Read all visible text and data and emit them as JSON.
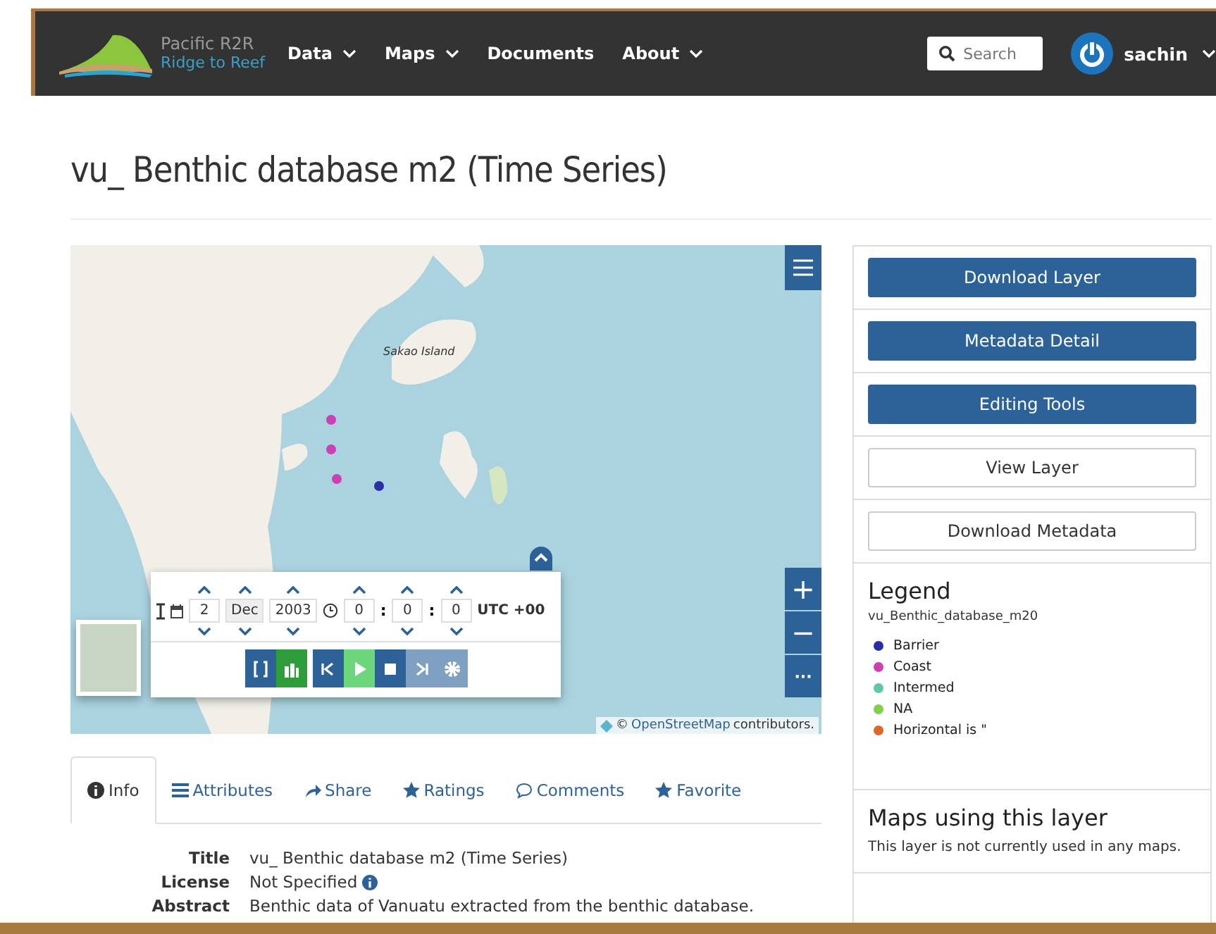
{
  "navbar": {
    "logo_line1": "Pacific R2R",
    "logo_line2": "Ridge to Reef",
    "menu": [
      {
        "label": "Data",
        "dropdown": true
      },
      {
        "label": "Maps",
        "dropdown": true
      },
      {
        "label": "Documents",
        "dropdown": false
      },
      {
        "label": "About",
        "dropdown": true
      }
    ],
    "search": {
      "placeholder": "Search"
    },
    "user": "sachin"
  },
  "page_title": "vu_ Benthic database m2 (Time Series)",
  "map": {
    "place_label": "Sakao Island",
    "attribution_link": "OpenStreetMap",
    "attribution_text": "contributors.",
    "copyright": "©",
    "time": {
      "fields": [
        {
          "kind": "day",
          "value": "2"
        },
        {
          "kind": "month",
          "value": "Dec"
        },
        {
          "kind": "year",
          "value": "2003"
        },
        {
          "kind": "hour",
          "value": "0"
        },
        {
          "kind": "minute",
          "value": "0",
          "separator": ":"
        },
        {
          "kind": "second",
          "value": "0",
          "separator": ":"
        }
      ],
      "zone": "UTC +00"
    },
    "player": [
      {
        "kind": "range",
        "disabled": false
      },
      {
        "kind": "layers",
        "disabled": false
      },
      {
        "kind": "first",
        "disabled": false
      },
      {
        "kind": "play",
        "disabled": false
      },
      {
        "kind": "stop",
        "disabled": false
      },
      {
        "kind": "last",
        "disabled": true
      },
      {
        "kind": "settings",
        "disabled": true
      }
    ],
    "zoom_in": "+",
    "zoom_out": "−",
    "more": "···"
  },
  "actions": [
    {
      "label": "Download Layer",
      "primary": true
    },
    {
      "label": "Metadata Detail",
      "primary": true
    },
    {
      "label": "Editing Tools",
      "primary": true
    },
    {
      "label": "View Layer",
      "primary": false
    },
    {
      "label": "Download Metadata",
      "primary": false
    }
  ],
  "legend": {
    "title": "Legend",
    "layer": "vu_Benthic_database_m20",
    "items": [
      {
        "label": "Barrier",
        "color": "#2a2fa8"
      },
      {
        "label": "Coast",
        "color": "#cc3fb5"
      },
      {
        "label": "Intermed",
        "color": "#5cc8a8"
      },
      {
        "label": "NA",
        "color": "#7fd04a"
      },
      {
        "label": "Horizontal is \"",
        "color": "#e0662a"
      }
    ]
  },
  "maps_using": {
    "title": "Maps using this layer",
    "text": "This layer is not currently used in any maps."
  },
  "tabs": [
    {
      "label": "Info",
      "kind": "info",
      "selected": true
    },
    {
      "label": "Attributes",
      "kind": "list",
      "selected": false
    },
    {
      "label": "Share",
      "kind": "share",
      "selected": false
    },
    {
      "label": "Ratings",
      "kind": "star",
      "selected": false
    },
    {
      "label": "Comments",
      "kind": "comment",
      "selected": false
    },
    {
      "label": "Favorite",
      "kind": "star",
      "selected": false
    }
  ],
  "info": [
    {
      "key": "Title",
      "value": "vu_ Benthic database m2 (Time Series)",
      "info_icon": false
    },
    {
      "key": "License",
      "value": "Not Specified",
      "info_icon": true
    },
    {
      "key": "Abstract",
      "value": "Benthic data of Vanuatu extracted from the benthic database.",
      "info_icon": false
    }
  ]
}
